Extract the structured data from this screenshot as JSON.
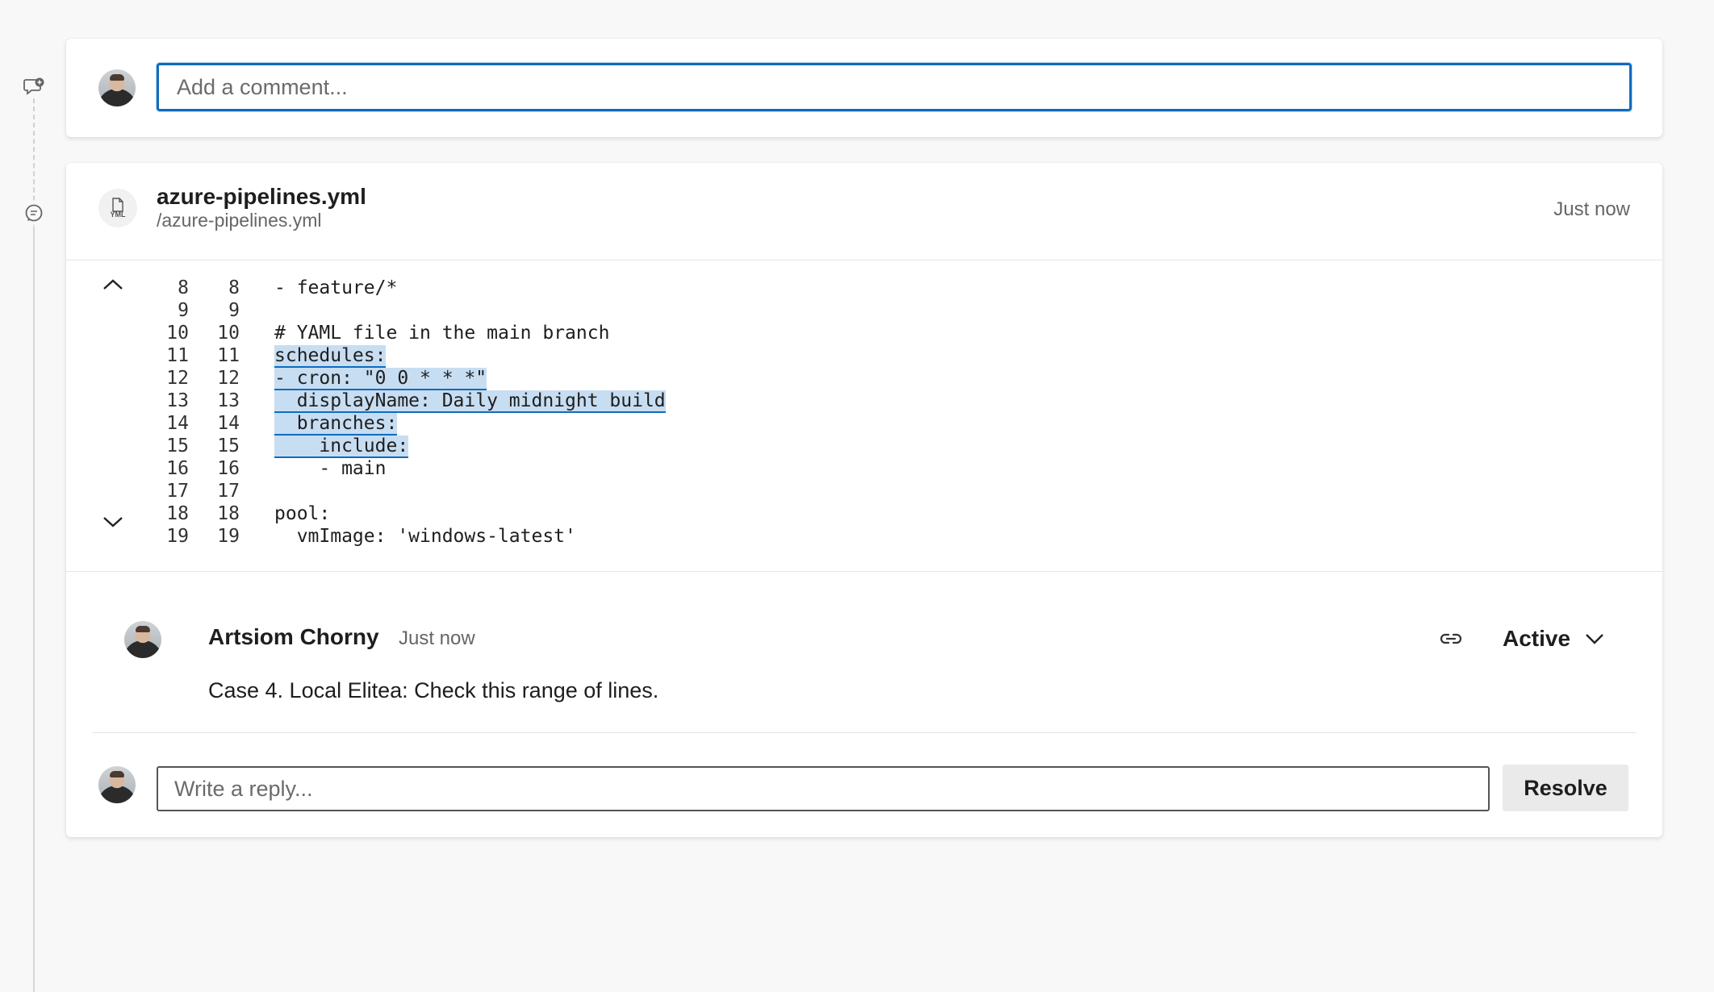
{
  "new_comment": {
    "placeholder": "Add a comment..."
  },
  "thread": {
    "file_name": "azure-pipelines.yml",
    "file_path": "/azure-pipelines.yml",
    "file_ext": "YML",
    "timestamp": "Just now",
    "code_lines": [
      {
        "left": "8",
        "right": "8",
        "text": "- feature/*",
        "highlighted": false
      },
      {
        "left": "9",
        "right": "9",
        "text": "",
        "highlighted": false
      },
      {
        "left": "10",
        "right": "10",
        "text": "# YAML file in the main branch",
        "highlighted": false
      },
      {
        "left": "11",
        "right": "11",
        "text": "schedules:",
        "highlighted": true
      },
      {
        "left": "12",
        "right": "12",
        "text": "- cron: \"0 0 * * *\"",
        "highlighted": true
      },
      {
        "left": "13",
        "right": "13",
        "text": "  displayName: Daily midnight build",
        "highlighted": true
      },
      {
        "left": "14",
        "right": "14",
        "text": "  branches:",
        "highlighted": true
      },
      {
        "left": "15",
        "right": "15",
        "text": "    include:",
        "highlighted": true
      },
      {
        "left": "16",
        "right": "16",
        "text": "    - main",
        "highlighted": false
      },
      {
        "left": "17",
        "right": "17",
        "text": "",
        "highlighted": false
      },
      {
        "left": "18",
        "right": "18",
        "text": "pool:",
        "highlighted": false
      },
      {
        "left": "19",
        "right": "19",
        "text": "  vmImage: 'windows-latest'",
        "highlighted": false
      }
    ],
    "comment": {
      "author": "Artsiom Chorny",
      "time": "Just now",
      "text": "Case 4. Local Elitea: Check this range of lines.",
      "status": "Active"
    },
    "reply": {
      "placeholder": "Write a reply...",
      "resolve_label": "Resolve"
    }
  },
  "colors": {
    "accent": "#0f6cbd",
    "highlight": "#c7ddf2",
    "background": "#f8f8f8"
  }
}
